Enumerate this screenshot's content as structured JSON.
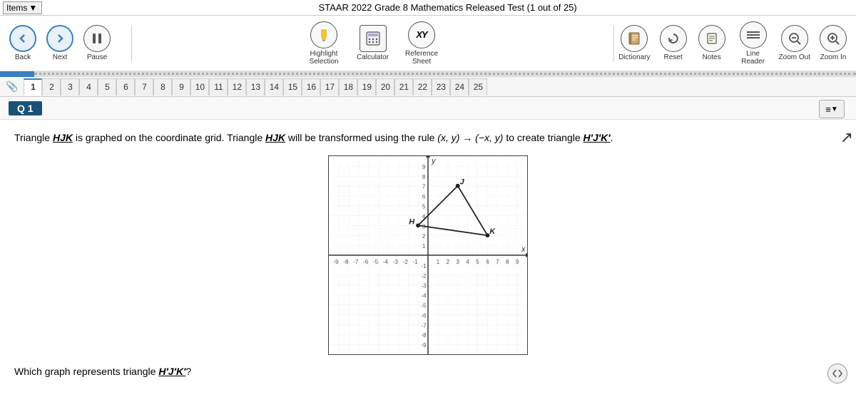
{
  "topbar": {
    "items_label": "Items",
    "title": "STAAR 2022 Grade 8 Mathematics Released Test (1 out of 25)"
  },
  "toolbar": {
    "back_label": "Back",
    "next_label": "Next",
    "pause_label": "Pause",
    "highlight_label": "Highlight Selection",
    "calculator_label": "Calculator",
    "reference_label": "Reference Sheet",
    "dictionary_label": "Dictionary",
    "reset_label": "Reset",
    "notes_label": "Notes",
    "line_reader_label": "Line Reader",
    "zoom_out_label": "Zoom Out",
    "zoom_in_label": "Zoom In"
  },
  "question_tabs": {
    "active": 1,
    "tabs": [
      1,
      2,
      3,
      4,
      5,
      6,
      7,
      8,
      9,
      10,
      11,
      12,
      13,
      14,
      15,
      16,
      17,
      18,
      19,
      20,
      21,
      22,
      23,
      24,
      25
    ]
  },
  "question": {
    "number": "Q 1",
    "text_part1": "Triangle ",
    "hjk1": "HJK",
    "text_part2": " is graphed on the coordinate grid. Triangle ",
    "hjk2": "HJK",
    "text_part3": " will be transformed using the rule ",
    "rule": "(x, y) → (−x, y)",
    "text_part4": " to create triangle ",
    "hpjpkp": "H′J′K′",
    "text_part5": ".",
    "sub_question": "Which graph represents triangle ",
    "hpjpkp2": "H′J′K′",
    "sub_q_end": "?"
  },
  "graph": {
    "x_label": "x",
    "y_label": "y",
    "x_min": -9,
    "x_max": 9,
    "y_min": -9,
    "y_max": 9,
    "points": {
      "H": {
        "x": -1,
        "y": 3,
        "label": "H"
      },
      "J": {
        "x": 3,
        "y": 7,
        "label": "J"
      },
      "K": {
        "x": 6,
        "y": 2,
        "label": "K"
      }
    }
  },
  "colors": {
    "accent": "#3a7fc1",
    "nav_bg": "#e8f0f8",
    "active_tab_border": "#3a7fc1",
    "q_label_bg": "#1a5276"
  }
}
